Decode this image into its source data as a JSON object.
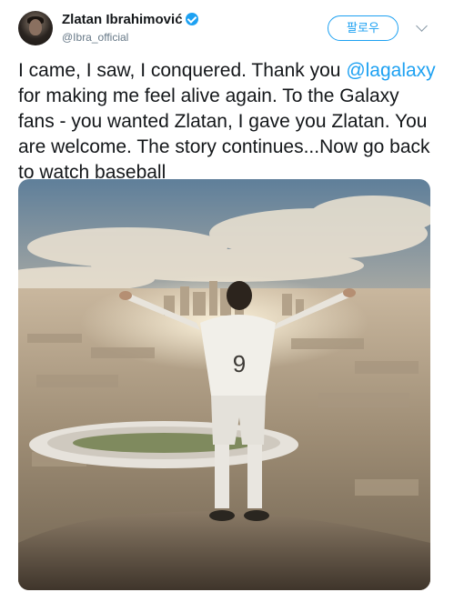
{
  "author": {
    "display_name": "Zlatan Ibrahimović",
    "handle": "@Ibra_official",
    "verified": true
  },
  "follow_button": {
    "label": "팔로우"
  },
  "tweet": {
    "text_before": "I came, I saw, I conquered. Thank you ",
    "mention": "@lagalaxy",
    "text_after": " for making me feel alive again. To the Galaxy fans -  you wanted Zlatan, I gave you Zlatan. You are welcome. The story continues...Now go back to watch baseball"
  },
  "media": {
    "jersey_number": "9"
  },
  "colors": {
    "accent": "#1da1f2",
    "text": "#14171a",
    "secondary": "#657786"
  }
}
